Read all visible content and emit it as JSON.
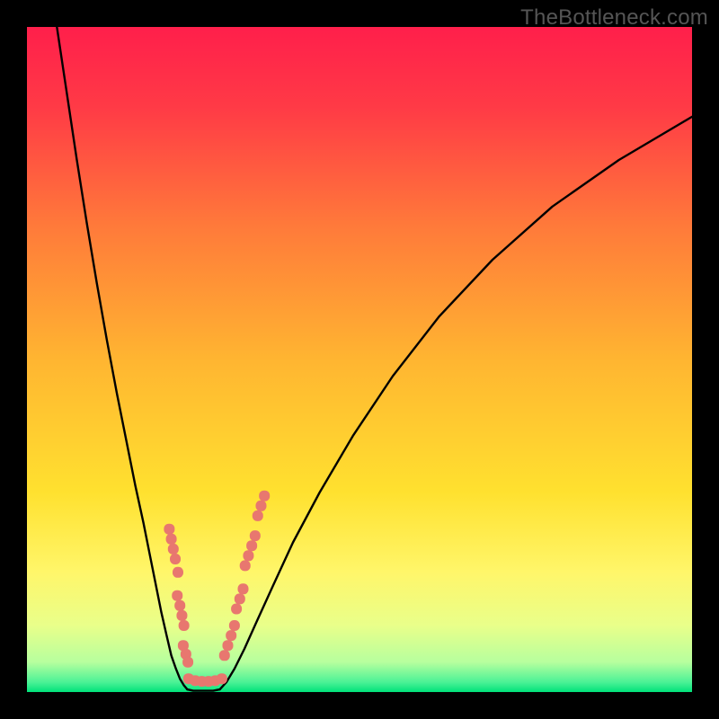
{
  "watermark": "TheBottleneck.com",
  "chart_data": {
    "type": "line",
    "title": "",
    "xlabel": "",
    "ylabel": "",
    "xlim": [
      0,
      100
    ],
    "ylim": [
      0,
      100
    ],
    "gradient_stops": [
      {
        "offset": 0.0,
        "color": "#ff1f4b"
      },
      {
        "offset": 0.12,
        "color": "#ff3a46"
      },
      {
        "offset": 0.3,
        "color": "#ff7a3a"
      },
      {
        "offset": 0.5,
        "color": "#ffb531"
      },
      {
        "offset": 0.7,
        "color": "#ffe12f"
      },
      {
        "offset": 0.82,
        "color": "#fff66a"
      },
      {
        "offset": 0.9,
        "color": "#e9ff8a"
      },
      {
        "offset": 0.955,
        "color": "#b7ff9e"
      },
      {
        "offset": 0.985,
        "color": "#4cf296"
      },
      {
        "offset": 1.0,
        "color": "#00e27a"
      }
    ],
    "series": [
      {
        "name": "left-branch",
        "stroke": "#000000",
        "x": [
          4.5,
          6.0,
          7.5,
          9.0,
          10.5,
          12.0,
          13.5,
          15.0,
          16.3,
          17.5,
          18.5,
          19.4,
          20.2,
          21.0,
          21.7,
          22.4,
          23.0,
          23.6,
          24.1
        ],
        "y": [
          100.0,
          90.0,
          80.0,
          70.5,
          61.5,
          53.0,
          45.0,
          37.5,
          31.0,
          25.5,
          20.5,
          16.0,
          12.0,
          8.5,
          5.5,
          3.5,
          2.0,
          1.0,
          0.4
        ]
      },
      {
        "name": "valley-floor",
        "stroke": "#000000",
        "x": [
          24.1,
          25.0,
          26.0,
          27.0,
          28.0,
          29.0
        ],
        "y": [
          0.4,
          0.2,
          0.2,
          0.2,
          0.2,
          0.4
        ]
      },
      {
        "name": "right-branch",
        "stroke": "#000000",
        "x": [
          29.0,
          30.0,
          31.2,
          32.7,
          34.5,
          37.0,
          40.0,
          44.0,
          49.0,
          55.0,
          62.0,
          70.0,
          79.0,
          89.0,
          100.0
        ],
        "y": [
          0.4,
          1.5,
          3.5,
          6.5,
          10.5,
          16.0,
          22.5,
          30.0,
          38.5,
          47.5,
          56.5,
          65.0,
          73.0,
          80.0,
          86.5
        ]
      }
    ],
    "dot_clusters": [
      {
        "name": "left-cluster",
        "color": "#e8776f",
        "points": [
          {
            "x": 21.4,
            "y": 24.5
          },
          {
            "x": 21.7,
            "y": 23.0
          },
          {
            "x": 22.0,
            "y": 21.5
          },
          {
            "x": 22.3,
            "y": 20.0
          },
          {
            "x": 22.7,
            "y": 18.0
          },
          {
            "x": 22.6,
            "y": 14.5
          },
          {
            "x": 23.0,
            "y": 13.0
          },
          {
            "x": 23.3,
            "y": 11.5
          },
          {
            "x": 23.6,
            "y": 10.0
          },
          {
            "x": 23.5,
            "y": 7.0
          },
          {
            "x": 23.9,
            "y": 5.7
          },
          {
            "x": 24.2,
            "y": 4.5
          }
        ]
      },
      {
        "name": "bottom-cluster",
        "color": "#e8776f",
        "points": [
          {
            "x": 24.3,
            "y": 2.0
          },
          {
            "x": 25.3,
            "y": 1.7
          },
          {
            "x": 26.3,
            "y": 1.6
          },
          {
            "x": 27.3,
            "y": 1.6
          },
          {
            "x": 28.3,
            "y": 1.7
          },
          {
            "x": 29.3,
            "y": 2.0
          }
        ]
      },
      {
        "name": "right-cluster",
        "color": "#e8776f",
        "points": [
          {
            "x": 29.7,
            "y": 5.5
          },
          {
            "x": 30.2,
            "y": 7.0
          },
          {
            "x": 30.7,
            "y": 8.5
          },
          {
            "x": 31.2,
            "y": 10.0
          },
          {
            "x": 31.5,
            "y": 12.5
          },
          {
            "x": 32.0,
            "y": 14.0
          },
          {
            "x": 32.5,
            "y": 15.5
          },
          {
            "x": 32.8,
            "y": 19.0
          },
          {
            "x": 33.3,
            "y": 20.5
          },
          {
            "x": 33.8,
            "y": 22.0
          },
          {
            "x": 34.3,
            "y": 23.5
          },
          {
            "x": 34.7,
            "y": 26.5
          },
          {
            "x": 35.2,
            "y": 28.0
          },
          {
            "x": 35.7,
            "y": 29.5
          }
        ]
      }
    ]
  }
}
